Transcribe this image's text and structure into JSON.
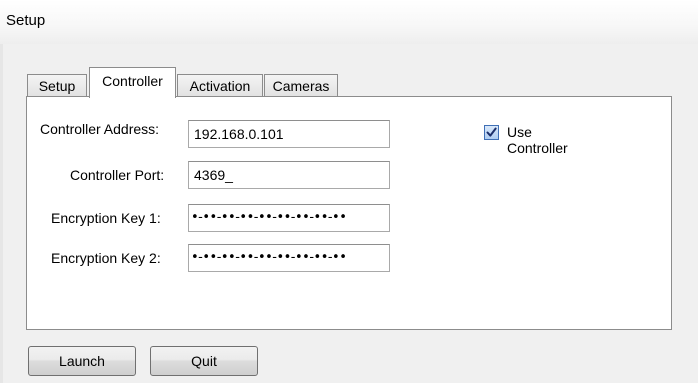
{
  "window": {
    "title": "Setup"
  },
  "tabs": [
    {
      "label": "Setup",
      "active": false
    },
    {
      "label": "Controller",
      "active": true
    },
    {
      "label": "Activation",
      "active": false
    },
    {
      "label": "Cameras",
      "active": false
    }
  ],
  "controller": {
    "address_label": "Controller Address:",
    "address_value": "192.168.0.101",
    "port_label": "Controller Port:",
    "port_value": "4369_",
    "key1_label": "Encryption Key 1:",
    "key1_value": "•-••-••-••-••-••-••-••-••",
    "key2_label": "Encryption Key 2:",
    "key2_value": "•-••-••-••-••-••-••-••-••",
    "use_controller_label": "Use Controller",
    "use_controller_checked": true
  },
  "buttons": {
    "launch_label": "Launch",
    "quit_label": "Quit"
  },
  "colors": {
    "checkbox_accent": "#3f6fb5",
    "panel_border": "#8c8c8c"
  },
  "icons": {
    "checkbox": "checkmark-icon"
  }
}
